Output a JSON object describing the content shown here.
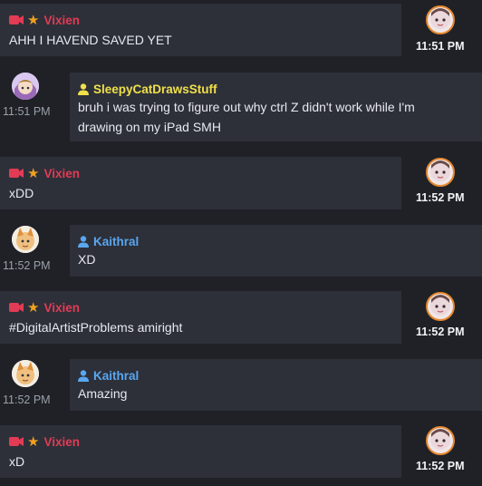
{
  "colors": {
    "background": "#1f2127",
    "bubble": "#2d3039",
    "vixien": "#e23b55",
    "sleepycat": "#f0e04a",
    "kaithral": "#5aa6ef",
    "star": "#f0a020",
    "avatar_ring": "#e6882e"
  },
  "messages": [
    {
      "author": "Vixien",
      "text": "AHH I HAVEND SAVED YET",
      "time": "11:51 PM"
    },
    {
      "author": "SleepyCatDrawsStuff",
      "text": "bruh i was trying to figure out why ctrl Z didn't work while I'm",
      "text2": "drawing on my iPad SMH",
      "time": "11:51 PM"
    },
    {
      "author": "Vixien",
      "text": "xDD",
      "time": "11:52 PM"
    },
    {
      "author": "Kaithral",
      "text": "XD",
      "time": "11:52 PM"
    },
    {
      "author": "Vixien",
      "text": "#DigitalArtistProblems amiright",
      "time": "11:52 PM"
    },
    {
      "author": "Kaithral",
      "text": "Amazing",
      "time": "11:52 PM"
    },
    {
      "author": "Vixien",
      "text": "xD",
      "time": "11:52 PM"
    }
  ],
  "icons": {
    "vixien": [
      "camera-icon",
      "star-icon"
    ],
    "sleepycat": "person-icon",
    "kaithral": "person-icon"
  }
}
